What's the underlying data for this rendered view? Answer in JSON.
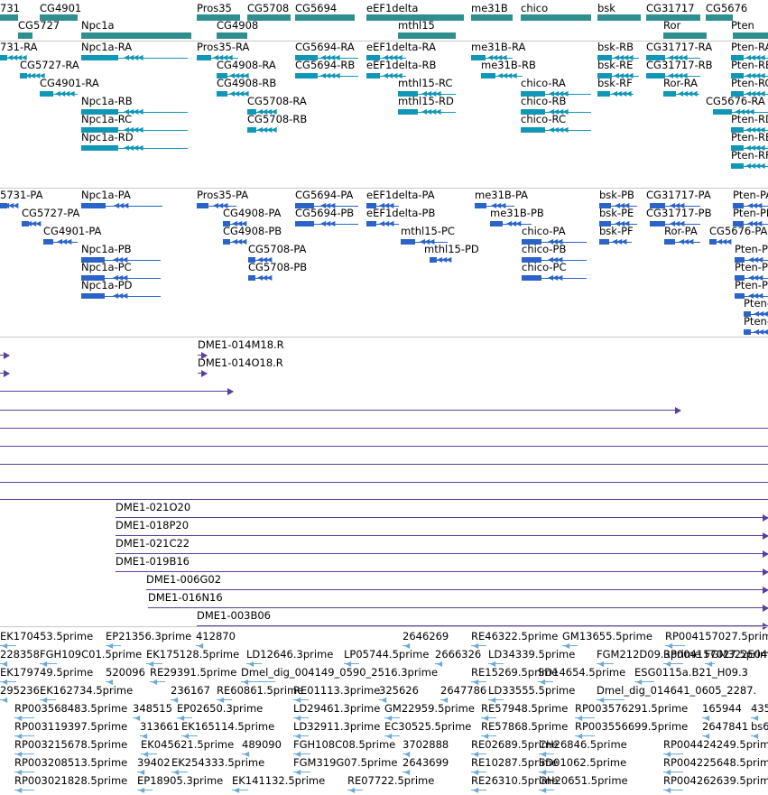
{
  "colors": {
    "gene_track": "#2f8f8f",
    "transcript_rna": "#1097b8",
    "transcript_protein": "#2a64c8",
    "bac_clone": "#5a3f9e",
    "est": "#6aaad8",
    "separator": "#c8c8c8"
  },
  "gene_track": {
    "labels": [
      "731",
      "CG4901",
      "Pros35",
      "CG5708",
      "CG5694",
      "eEF1delta",
      "me31B",
      "chico",
      "bsk",
      "CG31717",
      "CG5676",
      "CG5727",
      "Npc1a",
      "CG4908",
      "mthl15",
      "Ror",
      "Pten"
    ]
  },
  "rna_track": {
    "labels": [
      "731-RA",
      "Npc1a-RA",
      "Pros35-RA",
      "CG5694-RA",
      "eEF1delta-RA",
      "me31B-RA",
      "bsk-RB",
      "CG31717-RA",
      "Pten-RA",
      "CG5727-RA",
      "CG4908-RA",
      "CG5694-RB",
      "eEF1delta-RB",
      "me31B-RB",
      "bsk-RE",
      "CG31717-RB",
      "Pten-RB",
      "CG4901-RA",
      "CG4908-RB",
      "mthl15-RC",
      "chico-RA",
      "bsk-RF",
      "Ror-RA",
      "Pten-RC",
      "Npc1a-RB",
      "CG5708-RA",
      "mthl15-RD",
      "chico-RB",
      "CG5676-RA",
      "Npc1a-RC",
      "CG5708-RB",
      "chico-RC",
      "Pten-RD",
      "Npc1a-RD",
      "Pten-RE",
      "Pten-RF"
    ]
  },
  "protein_track": {
    "labels": [
      "5731-PA",
      "Npc1a-PA",
      "Pros35-PA",
      "CG5694-PA",
      "eEF1delta-PA",
      "me31B-PA",
      "bsk-PB",
      "CG31717-PA",
      "Pten-PA",
      "CG5727-PA",
      "CG4908-PA",
      "CG5694-PB",
      "eEF1delta-PB",
      "me31B-PB",
      "bsk-PE",
      "CG31717-PB",
      "Pten-PB",
      "CG4901-PA",
      "CG4908-PB",
      "mthl15-PC",
      "chico-PA",
      "bsk-PF",
      "Ror-PA",
      "CG5676-PA",
      "mthl15-PD",
      "chico-PB",
      "Npc1a-PB",
      "CG5708-PA",
      "Pten-PC",
      "Npc1a-PC",
      "CG5708-PB",
      "chico-PC",
      "Pten-PD",
      "Npc1a-PD",
      "Pten-PE",
      "Pten-PF",
      "Pten-PG"
    ]
  },
  "bac_track": {
    "labels": [
      "DME1-014M18.R",
      "DME1-014O18.R",
      "DME1-021O20",
      "DME1-018P20",
      "DME1-021C22",
      "DME1-019B16",
      "DME1-006G02",
      "DME1-016N16",
      "DME1-003B06"
    ]
  },
  "est_track": {
    "labels": [
      "EK170453.5prime",
      "EP21356.3prime",
      "412870",
      "2646269",
      "RE46322.5prime",
      "GM13655.5prime",
      "RP004157027.5prime",
      "228358",
      "FGH109C01.5prime",
      "EK175128.5prime",
      "LD12646.3prime",
      "LP05744.5prime",
      "2666326",
      "LD34339.5prime",
      "FGM212D09.3prime",
      "RP004157027.5prime",
      "FGM322E04",
      "EK179749.5prime",
      "520096",
      "RE29391.5prime",
      "Dmel_dig_004149_0590_2516.3prime",
      "RE15269.5prime",
      "SD14654.5prime",
      "ESG0115a.B21_H09.3",
      "295236",
      "EK162734.5prime",
      "236167",
      "RE60861.5prime",
      "RE01113.3prime",
      "325626",
      "2647786",
      "LD33555.5prime",
      "Dmel_dig_014641_0605_2287.",
      "RP003568483.5prime",
      "348515",
      "EP02650.3prime",
      "LD29461.3prime",
      "GM22959.5prime",
      "RE57948.5prime",
      "RP003576291.5prime",
      "165944",
      "435",
      "RP003119397.5prime",
      "313661",
      "EK165114.5prime",
      "LD32911.3prime",
      "EC30525.5prime",
      "RE57868.5prime",
      "RP003556699.5prime",
      "2647841",
      "bs6",
      "RP003215678.5prime",
      "EK045621.5prime",
      "489090",
      "FGH108C08.5prime",
      "3702888",
      "RE02689.5prime",
      "CH26846.5prime",
      "RP004424249.5prime",
      "RP003208513.5prime",
      "39402",
      "EK254333.5prime",
      "FGM319G07.5prime",
      "2643699",
      "RE10287.5prime",
      "SD01062.5prime",
      "RP004225648.5prime",
      "RP003021828.5prime",
      "EP18905.3prime",
      "EK141132.5prime",
      "RE07722.5prime",
      "RE26310.5prime",
      "GH20651.5prime",
      "RP004262639.5prime"
    ]
  }
}
